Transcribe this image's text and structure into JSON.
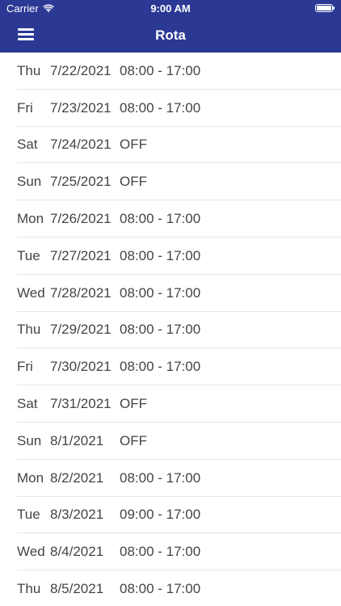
{
  "status_bar": {
    "carrier": "Carrier",
    "time": "9:00 AM"
  },
  "nav": {
    "title": "Rota",
    "menu_icon": "hamburger-menu-icon"
  },
  "colors": {
    "header_background": "#2b3994",
    "text": "#444444",
    "separator": "#e6e6e6"
  },
  "rota": [
    {
      "day": "Thu",
      "date": "7/22/2021",
      "shift": "08:00 - 17:00"
    },
    {
      "day": "Fri",
      "date": "7/23/2021",
      "shift": "08:00 - 17:00"
    },
    {
      "day": "Sat",
      "date": "7/24/2021",
      "shift": "OFF"
    },
    {
      "day": "Sun",
      "date": "7/25/2021",
      "shift": "OFF"
    },
    {
      "day": "Mon",
      "date": "7/26/2021",
      "shift": "08:00 - 17:00"
    },
    {
      "day": "Tue",
      "date": "7/27/2021",
      "shift": "08:00 - 17:00"
    },
    {
      "day": "Wed",
      "date": "7/28/2021",
      "shift": "08:00 - 17:00"
    },
    {
      "day": "Thu",
      "date": "7/29/2021",
      "shift": "08:00 - 17:00"
    },
    {
      "day": "Fri",
      "date": "7/30/2021",
      "shift": "08:00 - 17:00"
    },
    {
      "day": "Sat",
      "date": "7/31/2021",
      "shift": "OFF"
    },
    {
      "day": "Sun",
      "date": "8/1/2021",
      "shift": "OFF"
    },
    {
      "day": "Mon",
      "date": "8/2/2021",
      "shift": "08:00 - 17:00"
    },
    {
      "day": "Tue",
      "date": "8/3/2021",
      "shift": "09:00 - 17:00"
    },
    {
      "day": "Wed",
      "date": "8/4/2021",
      "shift": "08:00 - 17:00"
    },
    {
      "day": "Thu",
      "date": "8/5/2021",
      "shift": "08:00 - 17:00"
    }
  ]
}
